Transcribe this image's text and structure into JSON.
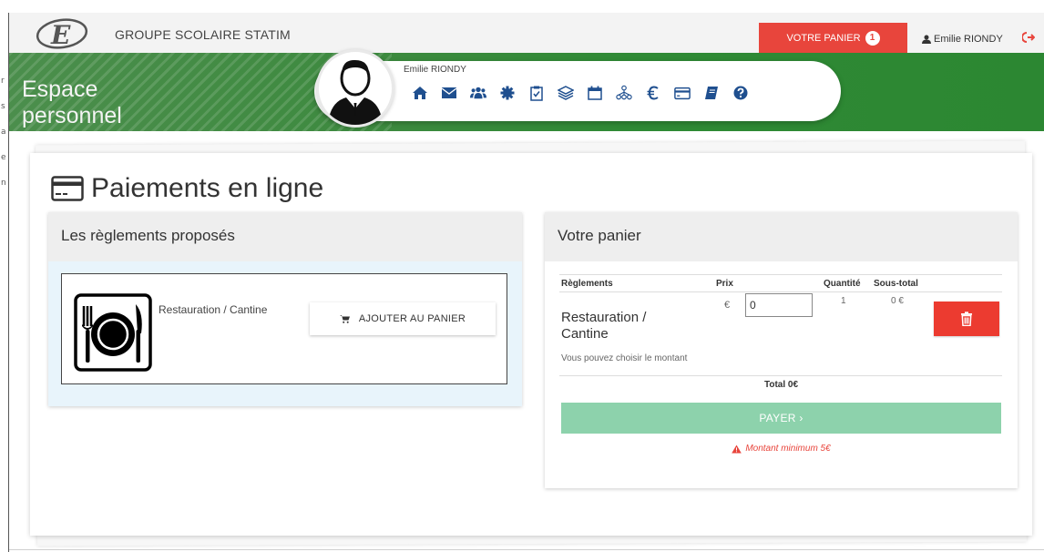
{
  "left_strip": [
    "r",
    "s",
    "a",
    "e",
    "n"
  ],
  "header": {
    "org_name": "GROUPE SCOLAIRE STATIM",
    "cart_label": "VOTRE PANIER",
    "cart_count": "1",
    "user_name": "Emilie RIONDY"
  },
  "banner": {
    "title_line1": "Espace",
    "title_line2": "personnel",
    "profile_name": "Emilie RIONDY",
    "nav_icons": [
      "home-icon",
      "envelope-icon",
      "users-icon",
      "gear-icon",
      "clipboard-check-icon",
      "layers-icon",
      "calendar-icon",
      "sitemap-icon",
      "euro-icon",
      "credit-card-icon",
      "book-icon",
      "question-circle-icon"
    ]
  },
  "page": {
    "title": "Paiements en ligne"
  },
  "offers_panel": {
    "title": "Les règlements proposés",
    "item_label": "Restauration / Cantine",
    "add_button": "AJOUTER AU PANIER"
  },
  "cart_panel": {
    "title": "Votre panier",
    "columns": {
      "reglements": "Règlements",
      "prix": "Prix",
      "quantite": "Quantité",
      "sous_total": "Sous-total"
    },
    "row": {
      "name": "Restauration / Cantine",
      "currency": "€",
      "price_value": "0",
      "quantity": "1",
      "subtotal": "0 €"
    },
    "note": "Vous pouvez choisir le montant",
    "total": "Total 0€",
    "pay_button": "PAYER ›",
    "warning": "Montant minimum 5€"
  },
  "colors": {
    "accent_red": "#e8453c",
    "banner_green": "#2f8a35",
    "pay_green": "#8dd2ac",
    "nav_icon_blue": "#1f4f8f"
  }
}
